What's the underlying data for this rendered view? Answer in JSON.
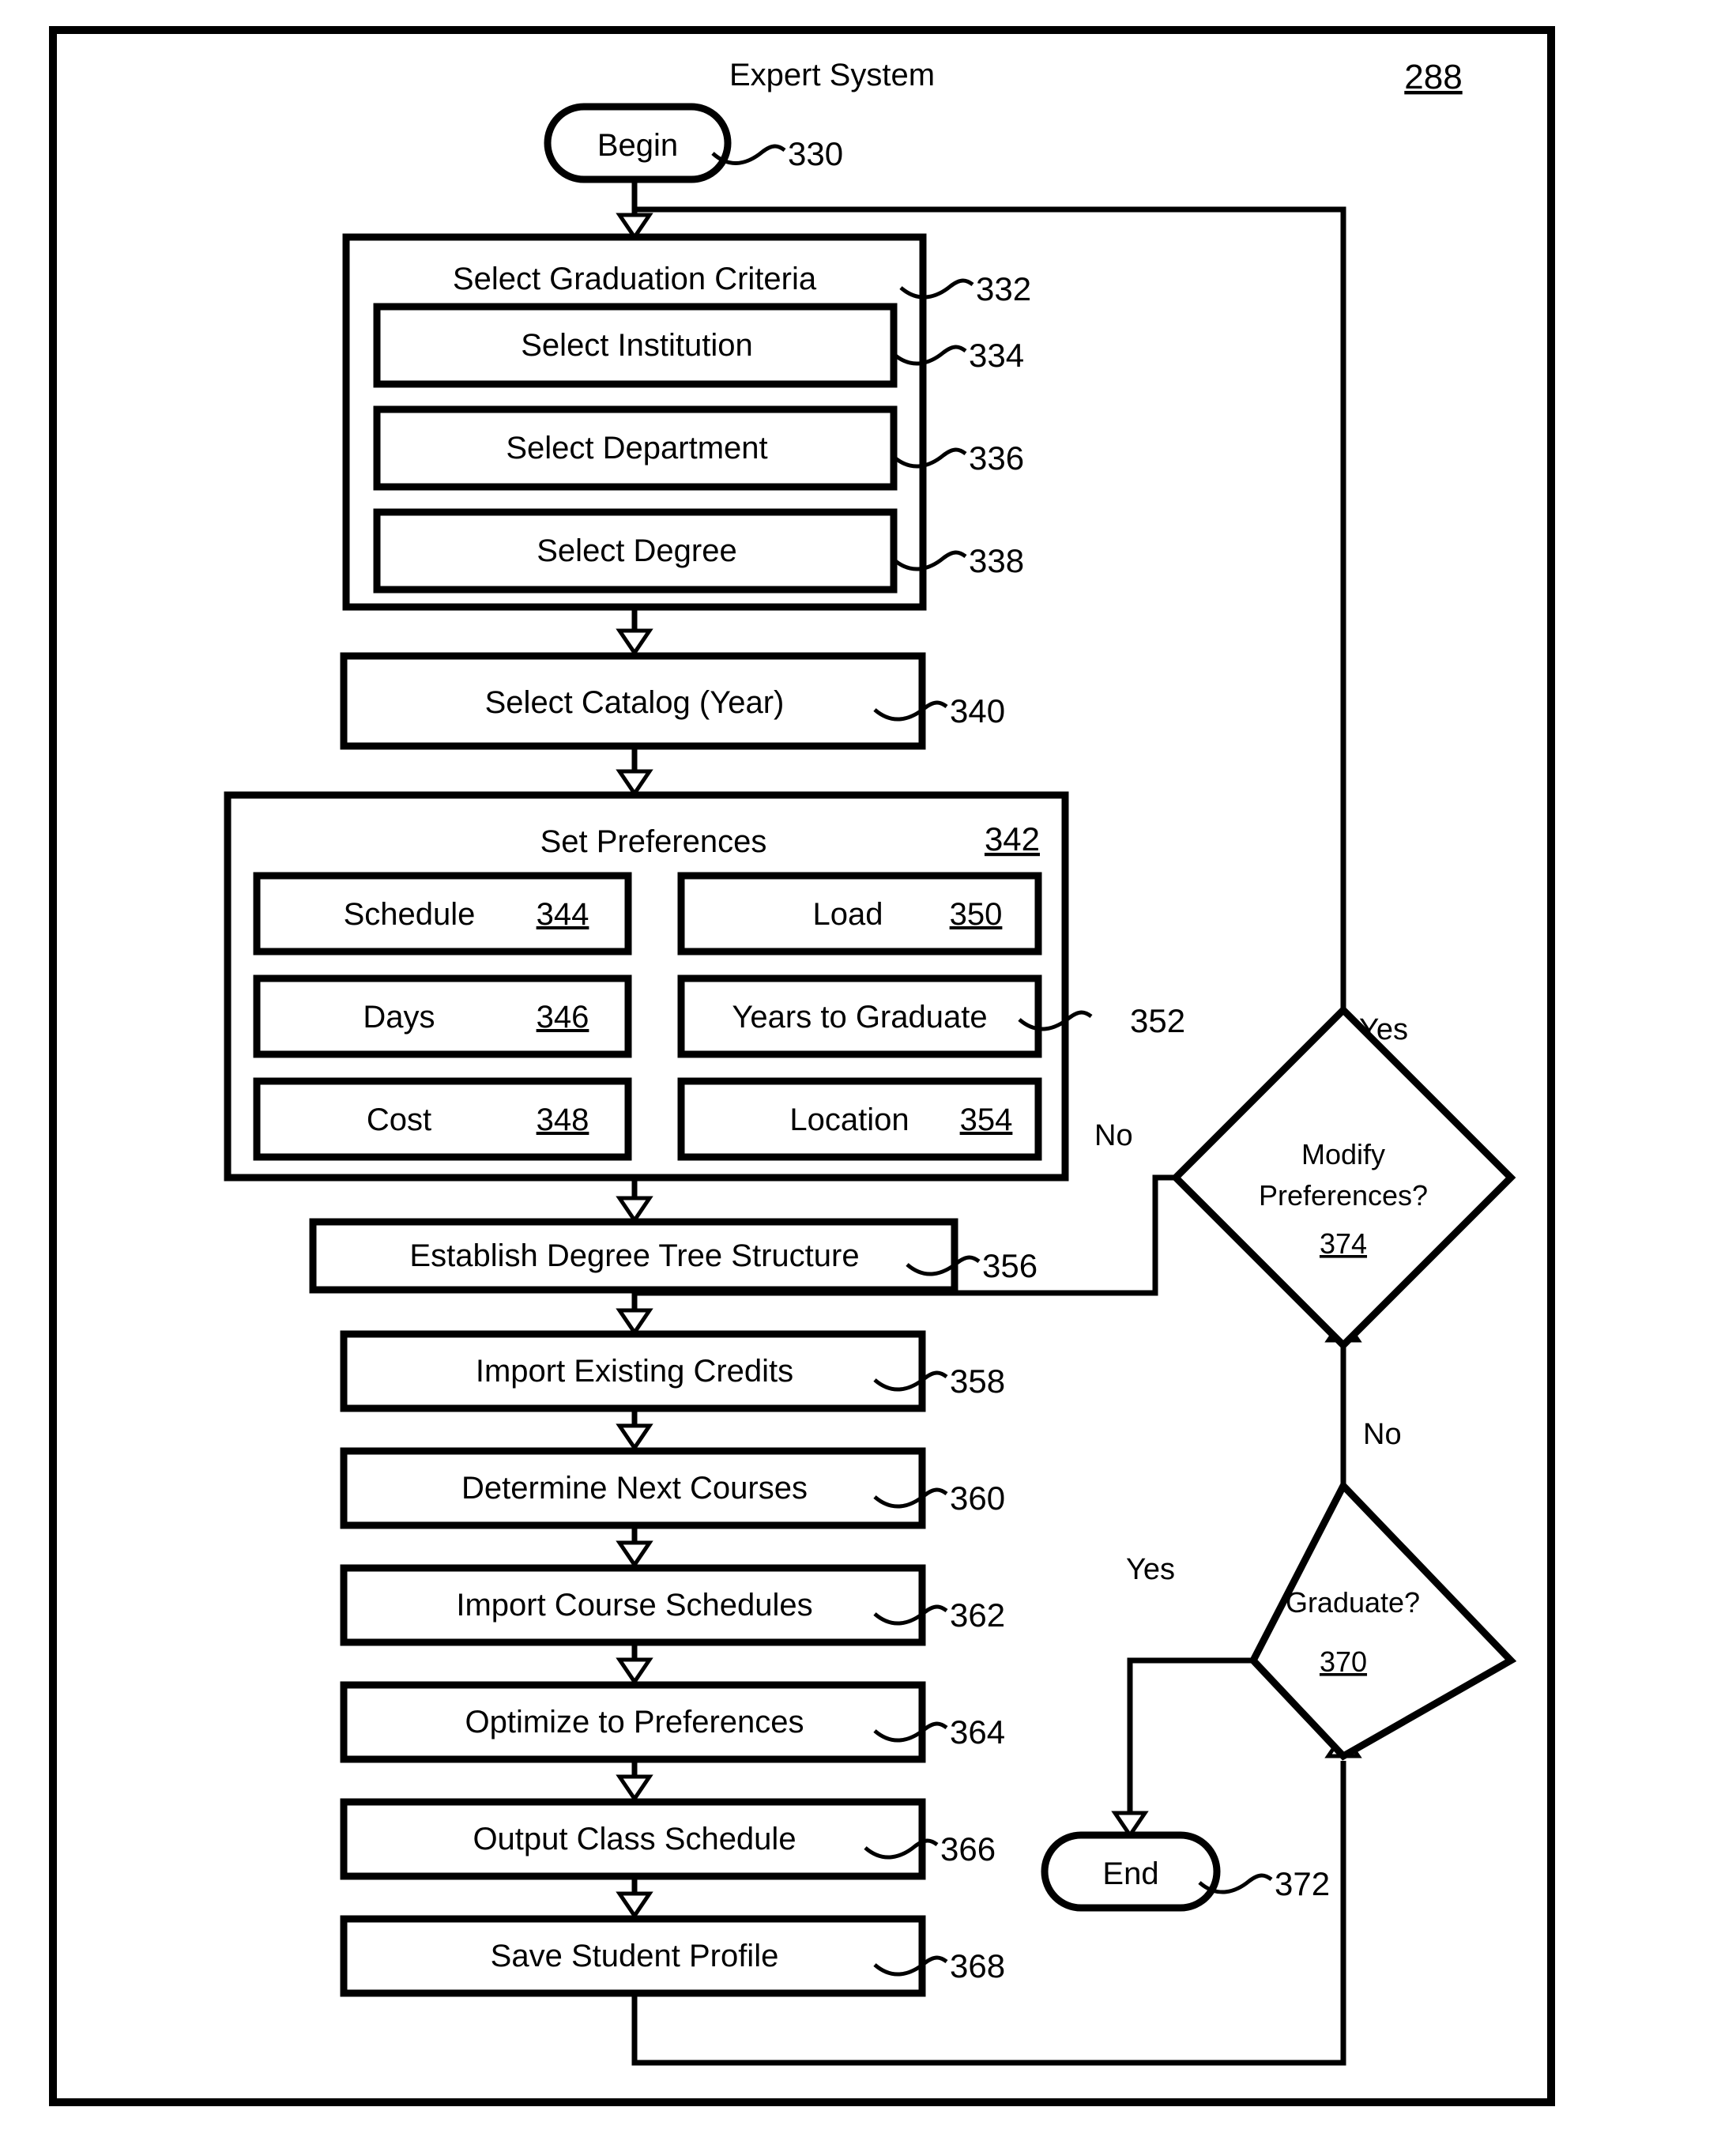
{
  "figure": {
    "title": "Expert System",
    "figure_number": "288"
  },
  "nodes": {
    "begin": {
      "label": "Begin",
      "ref": "330"
    },
    "graduation_criteria": {
      "label": "Select Graduation Criteria",
      "ref": "332",
      "items": [
        {
          "label": "Select Institution",
          "ref": "334"
        },
        {
          "label": "Select Department",
          "ref": "336"
        },
        {
          "label": "Select Degree",
          "ref": "338"
        }
      ]
    },
    "select_catalog": {
      "label": "Select Catalog (Year)",
      "ref": "340"
    },
    "set_preferences": {
      "label": "Set Preferences",
      "ref": "342",
      "items": [
        {
          "label": "Schedule",
          "ref": "344"
        },
        {
          "label": "Load",
          "ref": "350"
        },
        {
          "label": "Days",
          "ref": "346"
        },
        {
          "label": "Years to Graduate",
          "ref": "352"
        },
        {
          "label": "Cost",
          "ref": "348"
        },
        {
          "label": "Location",
          "ref": "354"
        }
      ]
    },
    "establish_tree": {
      "label": "Establish Degree Tree Structure",
      "ref": "356"
    },
    "import_credits": {
      "label": "Import Existing Credits",
      "ref": "358"
    },
    "determine_courses": {
      "label": "Determine Next Courses",
      "ref": "360"
    },
    "import_schedules": {
      "label": "Import Course Schedules",
      "ref": "362"
    },
    "optimize": {
      "label": "Optimize to Preferences",
      "ref": "364"
    },
    "output_schedule": {
      "label": "Output Class Schedule",
      "ref": "366"
    },
    "save_profile": {
      "label": "Save Student Profile",
      "ref": "368"
    },
    "modify_preferences": {
      "label_line1": "Modify",
      "label_line2": "Preferences?",
      "ref": "374",
      "branch_yes": "Yes",
      "branch_no": "No"
    },
    "graduate": {
      "label": "Graduate?",
      "ref": "370",
      "branch_yes": "Yes",
      "branch_no": "No"
    },
    "end": {
      "label": "End",
      "ref": "372"
    }
  },
  "colors": {
    "ink": "#000000",
    "paper": "#ffffff"
  }
}
